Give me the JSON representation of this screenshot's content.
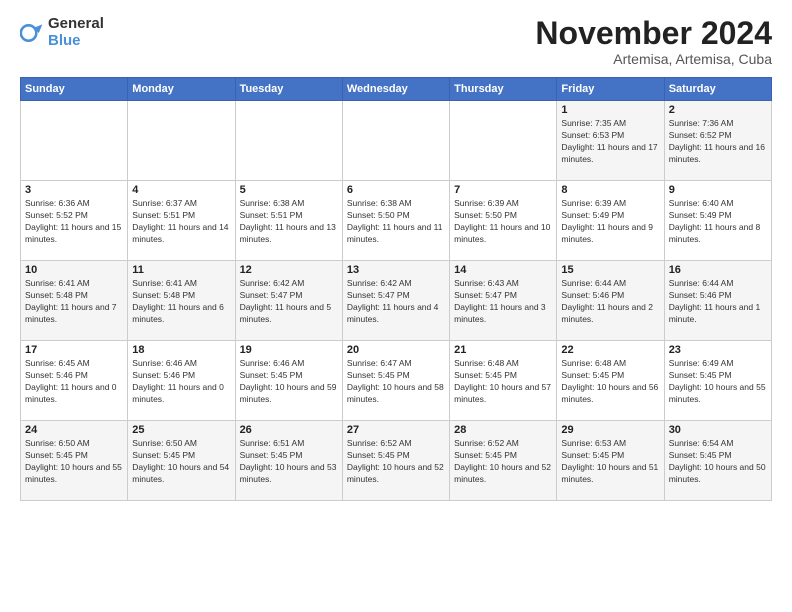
{
  "logo": {
    "text_general": "General",
    "text_blue": "Blue"
  },
  "title": "November 2024",
  "subtitle": "Artemisa, Artemisa, Cuba",
  "days_of_week": [
    "Sunday",
    "Monday",
    "Tuesday",
    "Wednesday",
    "Thursday",
    "Friday",
    "Saturday"
  ],
  "weeks": [
    [
      {
        "day": "",
        "sunrise": "",
        "sunset": "",
        "daylight": ""
      },
      {
        "day": "",
        "sunrise": "",
        "sunset": "",
        "daylight": ""
      },
      {
        "day": "",
        "sunrise": "",
        "sunset": "",
        "daylight": ""
      },
      {
        "day": "",
        "sunrise": "",
        "sunset": "",
        "daylight": ""
      },
      {
        "day": "",
        "sunrise": "",
        "sunset": "",
        "daylight": ""
      },
      {
        "day": "1",
        "sunrise": "Sunrise: 7:35 AM",
        "sunset": "Sunset: 6:53 PM",
        "daylight": "Daylight: 11 hours and 17 minutes."
      },
      {
        "day": "2",
        "sunrise": "Sunrise: 7:36 AM",
        "sunset": "Sunset: 6:52 PM",
        "daylight": "Daylight: 11 hours and 16 minutes."
      }
    ],
    [
      {
        "day": "3",
        "sunrise": "Sunrise: 6:36 AM",
        "sunset": "Sunset: 5:52 PM",
        "daylight": "Daylight: 11 hours and 15 minutes."
      },
      {
        "day": "4",
        "sunrise": "Sunrise: 6:37 AM",
        "sunset": "Sunset: 5:51 PM",
        "daylight": "Daylight: 11 hours and 14 minutes."
      },
      {
        "day": "5",
        "sunrise": "Sunrise: 6:38 AM",
        "sunset": "Sunset: 5:51 PM",
        "daylight": "Daylight: 11 hours and 13 minutes."
      },
      {
        "day": "6",
        "sunrise": "Sunrise: 6:38 AM",
        "sunset": "Sunset: 5:50 PM",
        "daylight": "Daylight: 11 hours and 11 minutes."
      },
      {
        "day": "7",
        "sunrise": "Sunrise: 6:39 AM",
        "sunset": "Sunset: 5:50 PM",
        "daylight": "Daylight: 11 hours and 10 minutes."
      },
      {
        "day": "8",
        "sunrise": "Sunrise: 6:39 AM",
        "sunset": "Sunset: 5:49 PM",
        "daylight": "Daylight: 11 hours and 9 minutes."
      },
      {
        "day": "9",
        "sunrise": "Sunrise: 6:40 AM",
        "sunset": "Sunset: 5:49 PM",
        "daylight": "Daylight: 11 hours and 8 minutes."
      }
    ],
    [
      {
        "day": "10",
        "sunrise": "Sunrise: 6:41 AM",
        "sunset": "Sunset: 5:48 PM",
        "daylight": "Daylight: 11 hours and 7 minutes."
      },
      {
        "day": "11",
        "sunrise": "Sunrise: 6:41 AM",
        "sunset": "Sunset: 5:48 PM",
        "daylight": "Daylight: 11 hours and 6 minutes."
      },
      {
        "day": "12",
        "sunrise": "Sunrise: 6:42 AM",
        "sunset": "Sunset: 5:47 PM",
        "daylight": "Daylight: 11 hours and 5 minutes."
      },
      {
        "day": "13",
        "sunrise": "Sunrise: 6:42 AM",
        "sunset": "Sunset: 5:47 PM",
        "daylight": "Daylight: 11 hours and 4 minutes."
      },
      {
        "day": "14",
        "sunrise": "Sunrise: 6:43 AM",
        "sunset": "Sunset: 5:47 PM",
        "daylight": "Daylight: 11 hours and 3 minutes."
      },
      {
        "day": "15",
        "sunrise": "Sunrise: 6:44 AM",
        "sunset": "Sunset: 5:46 PM",
        "daylight": "Daylight: 11 hours and 2 minutes."
      },
      {
        "day": "16",
        "sunrise": "Sunrise: 6:44 AM",
        "sunset": "Sunset: 5:46 PM",
        "daylight": "Daylight: 11 hours and 1 minute."
      }
    ],
    [
      {
        "day": "17",
        "sunrise": "Sunrise: 6:45 AM",
        "sunset": "Sunset: 5:46 PM",
        "daylight": "Daylight: 11 hours and 0 minutes."
      },
      {
        "day": "18",
        "sunrise": "Sunrise: 6:46 AM",
        "sunset": "Sunset: 5:46 PM",
        "daylight": "Daylight: 11 hours and 0 minutes."
      },
      {
        "day": "19",
        "sunrise": "Sunrise: 6:46 AM",
        "sunset": "Sunset: 5:45 PM",
        "daylight": "Daylight: 10 hours and 59 minutes."
      },
      {
        "day": "20",
        "sunrise": "Sunrise: 6:47 AM",
        "sunset": "Sunset: 5:45 PM",
        "daylight": "Daylight: 10 hours and 58 minutes."
      },
      {
        "day": "21",
        "sunrise": "Sunrise: 6:48 AM",
        "sunset": "Sunset: 5:45 PM",
        "daylight": "Daylight: 10 hours and 57 minutes."
      },
      {
        "day": "22",
        "sunrise": "Sunrise: 6:48 AM",
        "sunset": "Sunset: 5:45 PM",
        "daylight": "Daylight: 10 hours and 56 minutes."
      },
      {
        "day": "23",
        "sunrise": "Sunrise: 6:49 AM",
        "sunset": "Sunset: 5:45 PM",
        "daylight": "Daylight: 10 hours and 55 minutes."
      }
    ],
    [
      {
        "day": "24",
        "sunrise": "Sunrise: 6:50 AM",
        "sunset": "Sunset: 5:45 PM",
        "daylight": "Daylight: 10 hours and 55 minutes."
      },
      {
        "day": "25",
        "sunrise": "Sunrise: 6:50 AM",
        "sunset": "Sunset: 5:45 PM",
        "daylight": "Daylight: 10 hours and 54 minutes."
      },
      {
        "day": "26",
        "sunrise": "Sunrise: 6:51 AM",
        "sunset": "Sunset: 5:45 PM",
        "daylight": "Daylight: 10 hours and 53 minutes."
      },
      {
        "day": "27",
        "sunrise": "Sunrise: 6:52 AM",
        "sunset": "Sunset: 5:45 PM",
        "daylight": "Daylight: 10 hours and 52 minutes."
      },
      {
        "day": "28",
        "sunrise": "Sunrise: 6:52 AM",
        "sunset": "Sunset: 5:45 PM",
        "daylight": "Daylight: 10 hours and 52 minutes."
      },
      {
        "day": "29",
        "sunrise": "Sunrise: 6:53 AM",
        "sunset": "Sunset: 5:45 PM",
        "daylight": "Daylight: 10 hours and 51 minutes."
      },
      {
        "day": "30",
        "sunrise": "Sunrise: 6:54 AM",
        "sunset": "Sunset: 5:45 PM",
        "daylight": "Daylight: 10 hours and 50 minutes."
      }
    ]
  ]
}
